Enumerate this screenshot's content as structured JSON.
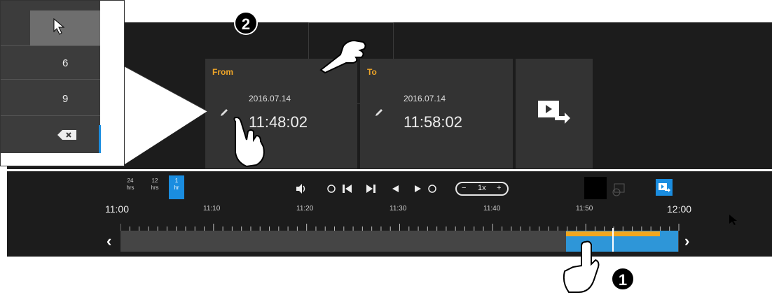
{
  "keypad": {
    "keys": [
      "6",
      "9"
    ]
  },
  "from_card": {
    "label": "From",
    "date": "2016.07.14",
    "time": "11:48:02"
  },
  "to_card": {
    "label": "To",
    "date": "2016.07.14",
    "time": "11:58:02"
  },
  "range_buttons": [
    {
      "top": "24",
      "bottom": "hrs"
    },
    {
      "top": "12",
      "bottom": "hrs"
    },
    {
      "top": "1",
      "bottom": "hr"
    }
  ],
  "speed_control": {
    "minus": "−",
    "value": "1x",
    "plus": "+"
  },
  "timeline": {
    "labels": [
      "11:00",
      "11:10",
      "11:20",
      "11:30",
      "11:40",
      "11:50",
      "12:00"
    ],
    "selection_start_fraction": 0.797,
    "recording_end_fraction": 0.966
  },
  "badges": {
    "one": "1",
    "two": "2"
  },
  "colors": {
    "accent": "#1a8de0",
    "orange": "#f2a71e",
    "from_label": "#f0a628",
    "selection": "#2e96d8"
  }
}
